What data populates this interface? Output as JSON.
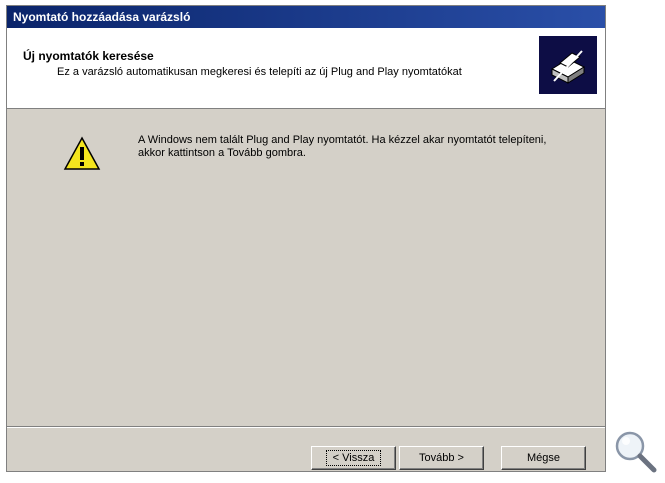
{
  "window": {
    "title": "Nyomtató hozzáadása varázsló"
  },
  "header": {
    "title": "Új nyomtatók keresése",
    "subtitle": "Ez a varázsló automatikusan megkeresi és telepíti az új Plug and Play nyomtatókat",
    "icon": "printer-wizard-icon"
  },
  "message": {
    "icon": "warning-icon",
    "text": "A Windows nem talált Plug and Play nyomtatót. Ha kézzel akar nyomtatót telepíteni, akkor kattintson a Tovább gombra."
  },
  "buttons": {
    "back": "< Vissza",
    "next": "Tovább >",
    "cancel": "Mégse"
  },
  "overlay": {
    "icon": "magnifier-icon"
  },
  "colors": {
    "titlebar": "#0a246a",
    "dialog_bg": "#d4d0c8",
    "warning": "#f4e51e"
  }
}
